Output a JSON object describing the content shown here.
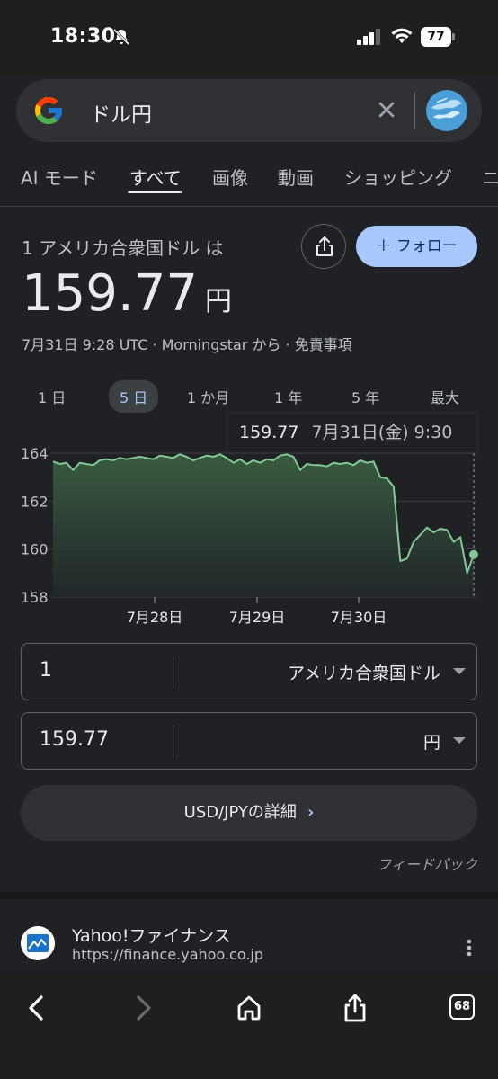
{
  "status_bar": {
    "time": "18:30",
    "battery": "77"
  },
  "search": {
    "query": "ドル円"
  },
  "tabs": [
    {
      "label": "AI モード",
      "active": false
    },
    {
      "label": "すべて",
      "active": true
    },
    {
      "label": "画像",
      "active": false
    },
    {
      "label": "動画",
      "active": false
    },
    {
      "label": "ショッピング",
      "active": false
    },
    {
      "label": "ニ",
      "active": false
    }
  ],
  "converter": {
    "label": "1 アメリカ合衆国ドル は",
    "value": "159.77",
    "unit": "円",
    "follow_label": "＋ フォロー",
    "meta": "7月31日 9:28 UTC · Morningstar から · 免責事項"
  },
  "ranges": [
    {
      "label": "1 日",
      "active": false
    },
    {
      "label": "5 日",
      "active": true
    },
    {
      "label": "1 か月",
      "active": false
    },
    {
      "label": "1 年",
      "active": false
    },
    {
      "label": "5 年",
      "active": false
    },
    {
      "label": "最大",
      "active": false
    }
  ],
  "tooltip": {
    "value": "159.77",
    "date": "7月31日(金) 9:30"
  },
  "chart_data": {
    "type": "area",
    "y_ticks": [
      "164",
      "162",
      "160",
      "158"
    ],
    "ylim": [
      158,
      164
    ],
    "x_ticks": [
      "7月28日",
      "7月29日",
      "7月30日"
    ],
    "series": [
      {
        "values": [
          163.65,
          163.55,
          163.6,
          163.3,
          163.6,
          163.55,
          163.5,
          163.7,
          163.75,
          163.7,
          163.8,
          163.75,
          163.8,
          163.85,
          163.8,
          163.75,
          163.9,
          163.85,
          163.8,
          163.95,
          163.85,
          163.7,
          163.8,
          163.9,
          163.85,
          163.95,
          163.8,
          163.6,
          163.75,
          163.55,
          163.7,
          163.6,
          163.75,
          163.7,
          163.9,
          163.95,
          163.85,
          163.3,
          163.55,
          163.5,
          163.5,
          163.45,
          163.6,
          163.55,
          163.6,
          163.5,
          163.7,
          163.6,
          163.65,
          163.0,
          162.95,
          162.6,
          159.5,
          159.6,
          160.3,
          160.6,
          160.9,
          160.7,
          160.85,
          160.8,
          160.3,
          160.5,
          159.0,
          159.77
        ]
      }
    ]
  },
  "inputs": [
    {
      "amount": "1",
      "currency": "アメリカ合衆国ドル"
    },
    {
      "amount": "159.77",
      "currency": "円"
    }
  ],
  "details_label": "USD/JPYの詳細",
  "feedback_label": "フィードバック",
  "result": {
    "title": "Yahoo!ファイナンス",
    "url": "https://finance.yahoo.co.jp"
  },
  "bottom_bar": {
    "tab_count": "68"
  }
}
